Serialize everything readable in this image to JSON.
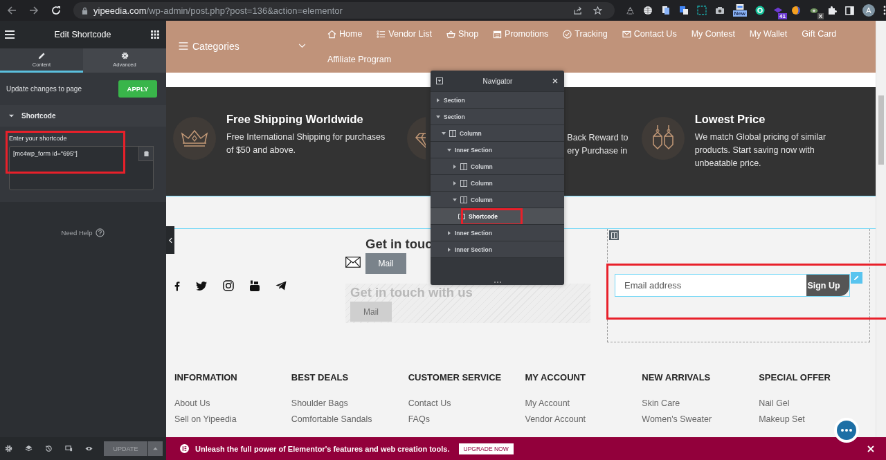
{
  "browser": {
    "url_host": "yipeedia.com",
    "url_path": "/wp-admin/post.php?post=136&action=elementor",
    "new_badge": "New",
    "count_badge": "41",
    "close_badge": "X",
    "profile_initial": "A"
  },
  "editor": {
    "title": "Edit Shortcode",
    "tabs": [
      {
        "label": "Content",
        "selected": true
      },
      {
        "label": "Advanced",
        "selected": false
      }
    ],
    "apply_prompt": "Update changes to page",
    "apply_button": "APPLY",
    "section": {
      "title": "Shortcode",
      "expanded": true
    },
    "field_label": "Enter your shortcode",
    "shortcode": "[mc4wp_form id=\"695\"]",
    "help": "Need Help",
    "update_button": "UPDATE"
  },
  "site": {
    "categories": "Categories",
    "menu": [
      {
        "label": "Home",
        "kind": "home"
      },
      {
        "label": "Vendor List",
        "kind": "list"
      },
      {
        "label": "Shop",
        "kind": "basket"
      },
      {
        "label": "Promotions",
        "kind": "calendar"
      },
      {
        "label": "Tracking",
        "kind": "check"
      },
      {
        "label": "Contact Us",
        "kind": "mail"
      },
      {
        "label": "My Contest"
      },
      {
        "label": "My Wallet"
      },
      {
        "label": "Gift Card"
      },
      {
        "label": "Affiliate Program"
      }
    ],
    "features": [
      {
        "kind": "crown",
        "title": "Free Shipping Worldwide",
        "lines": [
          "Free International Shipping for purchases",
          "of $50 and above."
        ]
      },
      {
        "kind": "diamond",
        "lines": [
          "Back Reward to",
          "ery Purchase in"
        ]
      },
      {
        "kind": "earrings",
        "title": "Lowest Price",
        "lines": [
          "We match Global pricing of similar",
          "products. Start saving now with",
          "unbeatable price."
        ]
      }
    ],
    "contact": {
      "heading": "Get in touc",
      "button": "Mail",
      "ghost_heading": "Get in touch with us",
      "ghost_button": "Mail"
    },
    "newsletter": {
      "placeholder": "Email address",
      "button": "Sign Up"
    },
    "footer": [
      {
        "heading": "INFORMATION",
        "links": [
          "About Us",
          "Sell on Yipeedia"
        ]
      },
      {
        "heading": "BEST DEALS",
        "links": [
          "Shoulder Bags",
          "Comfortable Sandals"
        ]
      },
      {
        "heading": "CUSTOMER SERVICE",
        "links": [
          "Contact Us",
          "FAQs"
        ]
      },
      {
        "heading": "MY ACCOUNT",
        "links": [
          "My Account",
          "Vendor Account"
        ]
      },
      {
        "heading": "NEW ARRIVALS",
        "links": [
          "Skin Care",
          "Women's Sweater"
        ]
      },
      {
        "heading": "SPECIAL OFFER",
        "links": [
          "Nail Gel",
          "Makeup Set"
        ]
      }
    ]
  },
  "navigator": {
    "title": "Navigator",
    "items": [
      {
        "label": "Section",
        "kind": "section",
        "expanded": false,
        "selected": false
      },
      {
        "label": "Section",
        "kind": "section",
        "expanded": true,
        "selected": false,
        "children": [
          {
            "label": "Column",
            "kind": "column",
            "expanded": true,
            "selected": false,
            "children": [
              {
                "label": "Inner Section",
                "kind": "section",
                "expanded": true,
                "selected": false,
                "children": [
                  {
                    "label": "Column",
                    "kind": "column",
                    "expanded": false,
                    "selected": false
                  },
                  {
                    "label": "Column",
                    "kind": "column",
                    "expanded": false,
                    "selected": false
                  },
                  {
                    "label": "Column",
                    "kind": "column",
                    "expanded": true,
                    "selected": false,
                    "children": [
                      {
                        "label": "Shortcode",
                        "kind": "widget",
                        "selected": true
                      }
                    ]
                  }
                ]
              },
              {
                "label": "Inner Section",
                "kind": "section",
                "expanded": false,
                "selected": false
              },
              {
                "label": "Inner Section",
                "kind": "section",
                "expanded": false,
                "selected": false
              }
            ]
          }
        ]
      }
    ]
  },
  "banner": {
    "text": "Unleash the full power of Elementor's features and web creation tools.",
    "button": "UPGRADE NOW"
  }
}
